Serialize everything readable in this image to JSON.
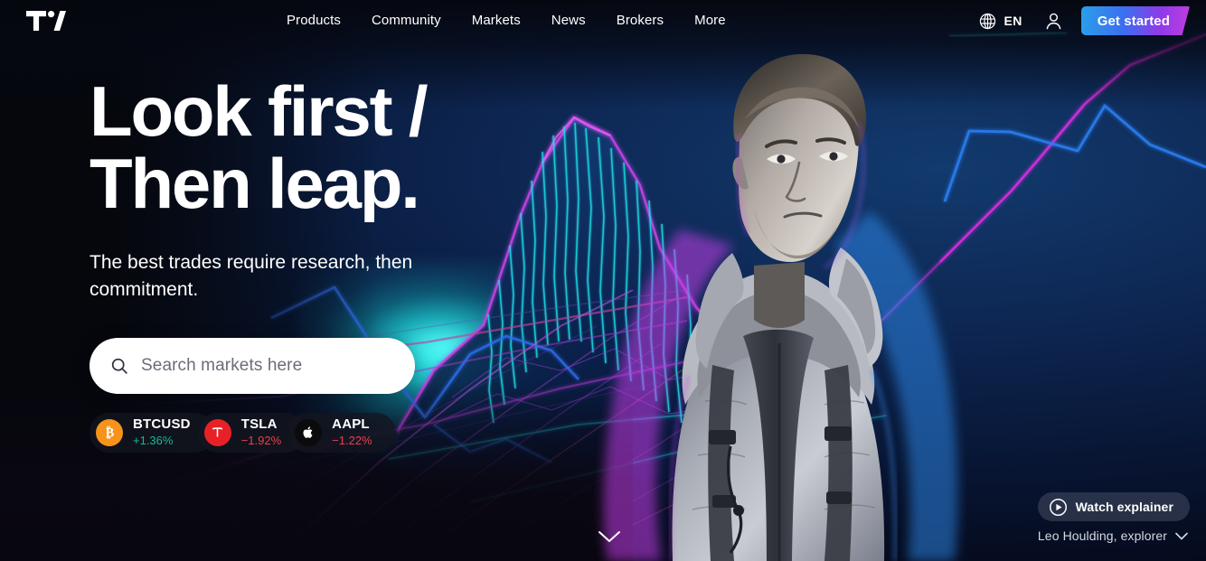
{
  "brand": {
    "name": "TradingView",
    "logo_icon": "tradingview-logo"
  },
  "header": {
    "nav": [
      {
        "label": "Products"
      },
      {
        "label": "Community"
      },
      {
        "label": "Markets"
      },
      {
        "label": "News"
      },
      {
        "label": "Brokers"
      },
      {
        "label": "More"
      }
    ],
    "language": {
      "icon": "globe-icon",
      "label": "EN"
    },
    "user_icon": "user-account-icon",
    "cta": {
      "label": "Get started",
      "gradient_from": "#2a9fe8",
      "gradient_to": "#c13ce0"
    }
  },
  "hero": {
    "headline_line1": "Look first /",
    "headline_line2": "Then leap.",
    "subheadline": "The best trades require research, then commitment.",
    "search": {
      "icon": "search-icon",
      "placeholder": "Search markets here",
      "value": ""
    }
  },
  "tickers": [
    {
      "symbol": "BTCUSD",
      "change": "+1.36%",
      "direction": "up",
      "icon": "bitcoin-icon",
      "icon_bg": "#f7931a",
      "change_color": "#17b89a"
    },
    {
      "symbol": "TSLA",
      "change": "−1.92%",
      "direction": "down",
      "icon": "tesla-icon",
      "icon_bg": "#e82127",
      "change_color": "#e8414f"
    },
    {
      "symbol": "AAPL",
      "change": "−1.22%",
      "direction": "down",
      "icon": "apple-icon",
      "icon_bg": "#0b0b0d",
      "change_color": "#e8414f"
    }
  ],
  "media": {
    "watch_label": "Watch explainer",
    "play_icon": "play-circle-icon",
    "credit": "Leo Houlding, explorer",
    "credit_chevron_icon": "chevron-down-icon"
  },
  "scroll_hint_icon": "chevron-down-icon",
  "colors": {
    "page_bg": "#05070d",
    "accent_blue": "#2a9fe8",
    "accent_magenta": "#c13ce0",
    "up_green": "#17b89a",
    "down_red": "#e8414f",
    "neon_cyan": "#22ebeb"
  }
}
